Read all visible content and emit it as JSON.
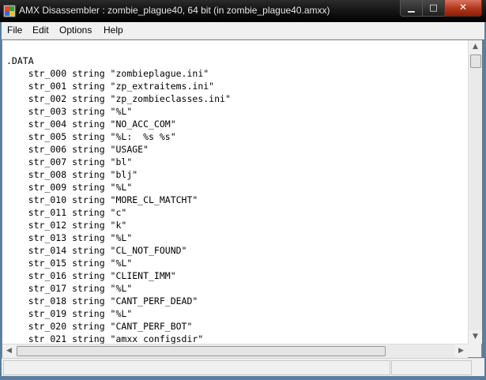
{
  "window": {
    "title": "AMX Disassembler : zombie_plague40, 64 bit (in zombie_plague40.amxx)",
    "controls": {
      "minimize": "▁",
      "maximize": "□",
      "close": "✕"
    }
  },
  "menu": [
    "File",
    "Edit",
    "Options",
    "Help"
  ],
  "code_lines": [
    ".DATA",
    "    str_000 string \"zombieplague.ini\"",
    "    str_001 string \"zp_extraitems.ini\"",
    "    str_002 string \"zp_zombieclasses.ini\"",
    "    str_003 string \"%L\"",
    "    str_004 string \"NO_ACC_COM\"",
    "    str_005 string \"%L:  %s %s\"",
    "    str_006 string \"USAGE\"",
    "    str_007 string \"bl\"",
    "    str_008 string \"blj\"",
    "    str_009 string \"%L\"",
    "    str_010 string \"MORE_CL_MATCHT\"",
    "    str_011 string \"c\"",
    "    str_012 string \"k\"",
    "    str_013 string \"%L\"",
    "    str_014 string \"CL_NOT_FOUND\"",
    "    str_015 string \"%L\"",
    "    str_016 string \"CLIENT_IMM\"",
    "    str_017 string \"%L\"",
    "    str_018 string \"CANT_PERF_DEAD\"",
    "    str_019 string \"%L\"",
    "    str_020 string \"CANT_PERF_BOT\"",
    "    str_021 string \"amxx configsdir\""
  ],
  "scroll_icons": {
    "up": "▲",
    "down": "▼",
    "left": "◀",
    "right": "▶"
  }
}
